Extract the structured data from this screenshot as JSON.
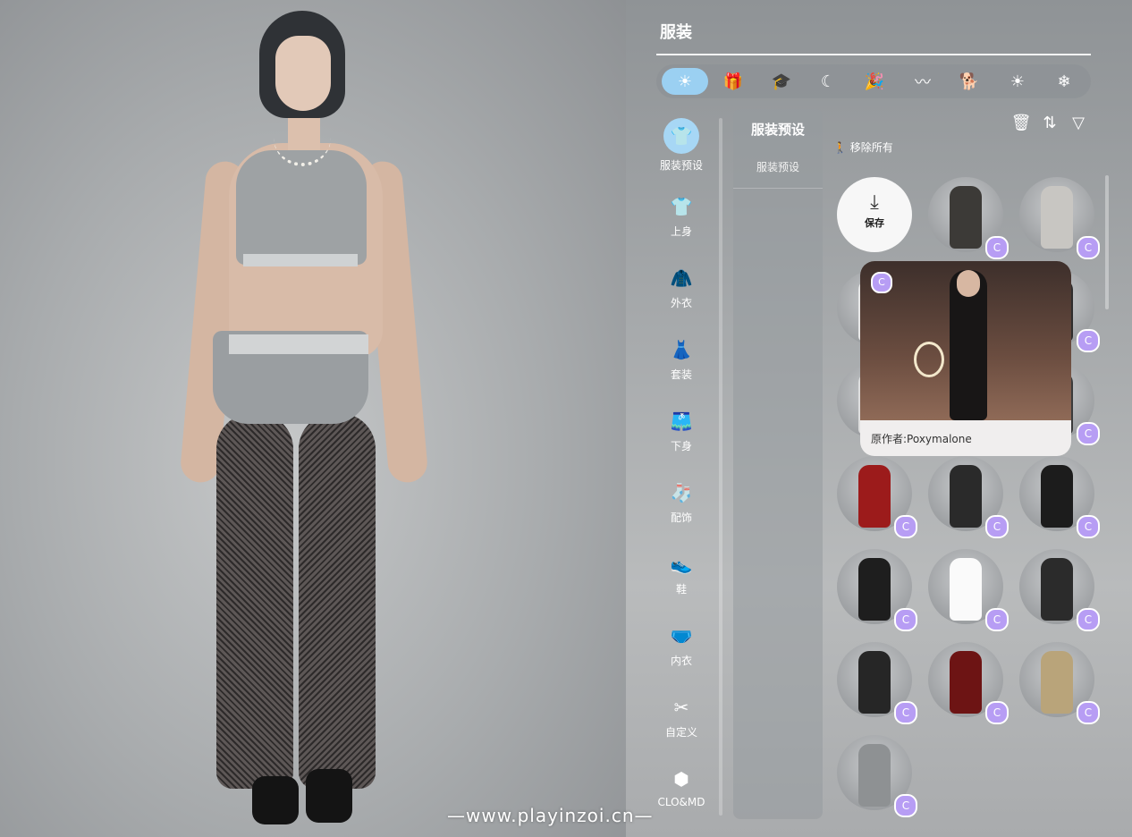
{
  "panel": {
    "title": "服装",
    "filters": [
      {
        "icon": "day-night-icon",
        "glyph": "☀",
        "active": true
      },
      {
        "icon": "gift-icon",
        "glyph": "🎁",
        "active": false
      },
      {
        "icon": "graduation-cap-icon",
        "glyph": "🎓",
        "active": false
      },
      {
        "icon": "sleep-icon",
        "glyph": "☾",
        "active": false
      },
      {
        "icon": "party-icon",
        "glyph": "🎉",
        "active": false
      },
      {
        "icon": "swim-icon",
        "glyph": "〰",
        "active": false
      },
      {
        "icon": "pet-walk-icon",
        "glyph": "🐕",
        "active": false
      },
      {
        "icon": "summer-icon",
        "glyph": "☀",
        "active": false
      },
      {
        "icon": "winter-icon",
        "glyph": "❄",
        "active": false
      }
    ]
  },
  "categories": [
    {
      "label": "服装预设",
      "icon": "outfit-preset-icon",
      "glyph": "👕",
      "active": true
    },
    {
      "label": "上身",
      "icon": "top-icon",
      "glyph": "👕",
      "active": false
    },
    {
      "label": "外衣",
      "icon": "outerwear-icon",
      "glyph": "🧥",
      "active": false
    },
    {
      "label": "套装",
      "icon": "dress-icon",
      "glyph": "👗",
      "active": false
    },
    {
      "label": "下身",
      "icon": "bottom-icon",
      "glyph": "🩳",
      "active": false
    },
    {
      "label": "配饰",
      "icon": "sock-icon",
      "glyph": "🧦",
      "active": false
    },
    {
      "label": "鞋",
      "icon": "shoe-icon",
      "glyph": "👟",
      "active": false
    },
    {
      "label": "内衣",
      "icon": "underwear-icon",
      "glyph": "🩲",
      "active": false
    },
    {
      "label": "自定义",
      "icon": "custom-icon",
      "glyph": "✂",
      "active": false
    },
    {
      "label": "CLO&MD",
      "icon": "clo-md-icon",
      "glyph": "⬢",
      "active": false
    }
  ],
  "preset": {
    "header": "服装预设",
    "item": "服装预设"
  },
  "toolbar": {
    "remove_all": "移除所有",
    "remove_all_glyph": "🚶"
  },
  "save": {
    "label": "保存"
  },
  "tiles": [
    {
      "color": "#3c3a37"
    },
    {
      "color": "#c8c6c2"
    },
    {
      "color": "#e8e8e8"
    },
    {
      "color": "#f2f2f2"
    },
    {
      "color": "#2f2d2d"
    },
    {
      "color": "#dedede"
    },
    {
      "color": "#4b3e55"
    },
    {
      "color": "#3b3b3b"
    },
    {
      "color": "#9c1b1b"
    },
    {
      "color": "#2a2a2a"
    },
    {
      "color": "#1c1c1c"
    },
    {
      "color": "#1e1e1e"
    },
    {
      "color": "#fafafa"
    },
    {
      "color": "#2b2b2b"
    },
    {
      "color": "#262626"
    },
    {
      "color": "#6d1414"
    },
    {
      "color": "#b9a47a"
    },
    {
      "color": "#8e9193"
    }
  ],
  "badge_glyph": "C",
  "tooltip": {
    "author": "原作者:Poxymalone",
    "badge_glyph": "C"
  },
  "watermark": "—www.playinzoi.cn—"
}
